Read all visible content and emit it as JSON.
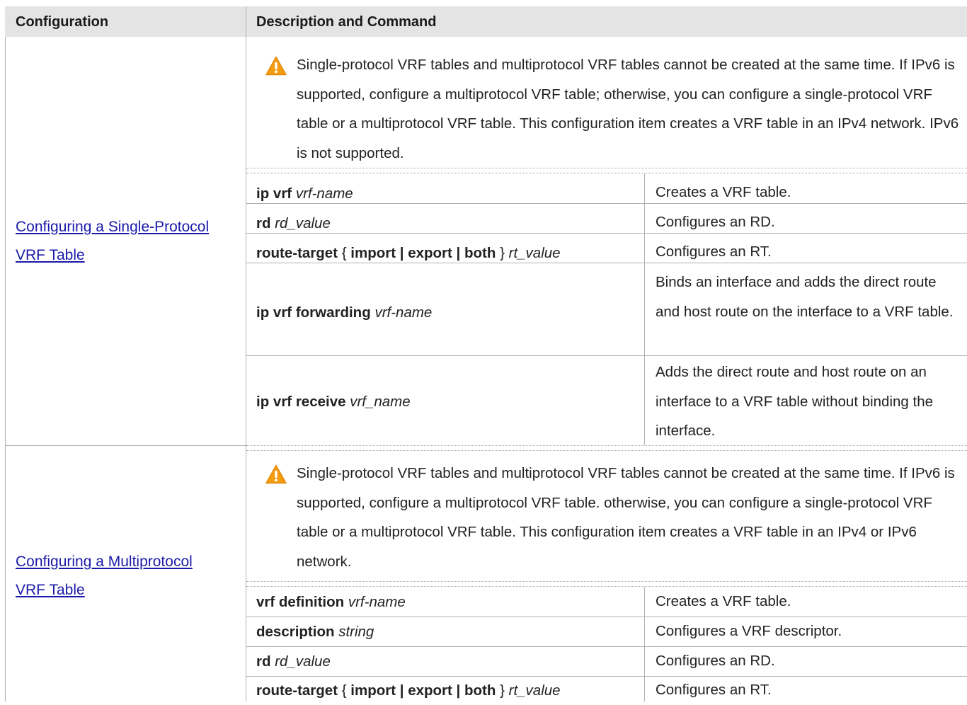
{
  "header": {
    "col_configuration": "Configuration",
    "col_description": "Description and Command"
  },
  "sections": [
    {
      "link_line1": "Configuring a Single-Protocol",
      "link_line2": "VRF Table",
      "note": "Single-protocol VRF tables and multiprotocol VRF tables cannot be created at the same time. If IPv6 is supported, configure a multiprotocol VRF table; otherwise, you can configure a single-protocol VRF table or a multiprotocol VRF table. This configuration item creates a VRF table in an IPv4 network. IPv6 is not supported.",
      "rows": [
        {
          "cmd": [
            {
              "t": "ip vrf",
              "s": "b"
            },
            {
              "t": " ",
              "s": ""
            },
            {
              "t": "vrf-name",
              "s": "i"
            }
          ],
          "desc": "Creates a VRF table."
        },
        {
          "cmd": [
            {
              "t": "rd",
              "s": "b"
            },
            {
              "t": " ",
              "s": ""
            },
            {
              "t": "rd_value",
              "s": "i"
            }
          ],
          "desc": "Configures an RD."
        },
        {
          "cmd": [
            {
              "t": "route-target",
              "s": "b"
            },
            {
              "t": " { ",
              "s": ""
            },
            {
              "t": "import | export | both",
              "s": "b"
            },
            {
              "t": " } ",
              "s": ""
            },
            {
              "t": "rt_value",
              "s": "i"
            }
          ],
          "desc": "Configures an RT."
        },
        {
          "cmd": [
            {
              "t": "ip vrf forwarding",
              "s": "b"
            },
            {
              "t": " ",
              "s": ""
            },
            {
              "t": "vrf-name",
              "s": "i"
            }
          ],
          "desc": "Binds an interface and adds the direct route and host route on the interface to a VRF table."
        },
        {
          "cmd": [
            {
              "t": "ip vrf receive",
              "s": "b"
            },
            {
              "t": " ",
              "s": ""
            },
            {
              "t": "vrf_name",
              "s": "i"
            }
          ],
          "desc": "Adds the direct route and host route on an interface to a VRF table without binding the interface."
        }
      ]
    },
    {
      "link_line1": "Configuring a Multiprotocol ",
      "link_line2": "VRF Table",
      "note": "Single-protocol VRF tables and multiprotocol VRF tables cannot be created at the same time. If IPv6 is supported, configure a multiprotocol VRF table. otherwise, you can configure a single-protocol VRF table or a multiprotocol VRF table. This configuration item creates a VRF table in an IPv4 or IPv6 network.",
      "rows": [
        {
          "cmd": [
            {
              "t": "vrf definition",
              "s": "b"
            },
            {
              "t": " ",
              "s": ""
            },
            {
              "t": "vrf-name",
              "s": "i"
            }
          ],
          "desc": "Creates a VRF table."
        },
        {
          "cmd": [
            {
              "t": "description",
              "s": "b"
            },
            {
              "t": " ",
              "s": ""
            },
            {
              "t": "string",
              "s": "i"
            }
          ],
          "desc": "Configures a VRF descriptor."
        },
        {
          "cmd": [
            {
              "t": "rd",
              "s": "b"
            },
            {
              "t": " ",
              "s": ""
            },
            {
              "t": "rd_value",
              "s": "i"
            }
          ],
          "desc": "Configures an RD."
        },
        {
          "cmd": [
            {
              "t": "route-target",
              "s": "b"
            },
            {
              "t": " { ",
              "s": ""
            },
            {
              "t": "import | export | both",
              "s": "b"
            },
            {
              "t": " } ",
              "s": ""
            },
            {
              "t": "rt_value",
              "s": "i"
            }
          ],
          "desc": "Configures an RT."
        }
      ]
    }
  ],
  "colors": {
    "header_bg": "#e4e4e4",
    "link": "#1a1aaa",
    "warning_icon": "#f39c12"
  },
  "icons": {
    "note_icon": "warning-triangle-icon"
  }
}
